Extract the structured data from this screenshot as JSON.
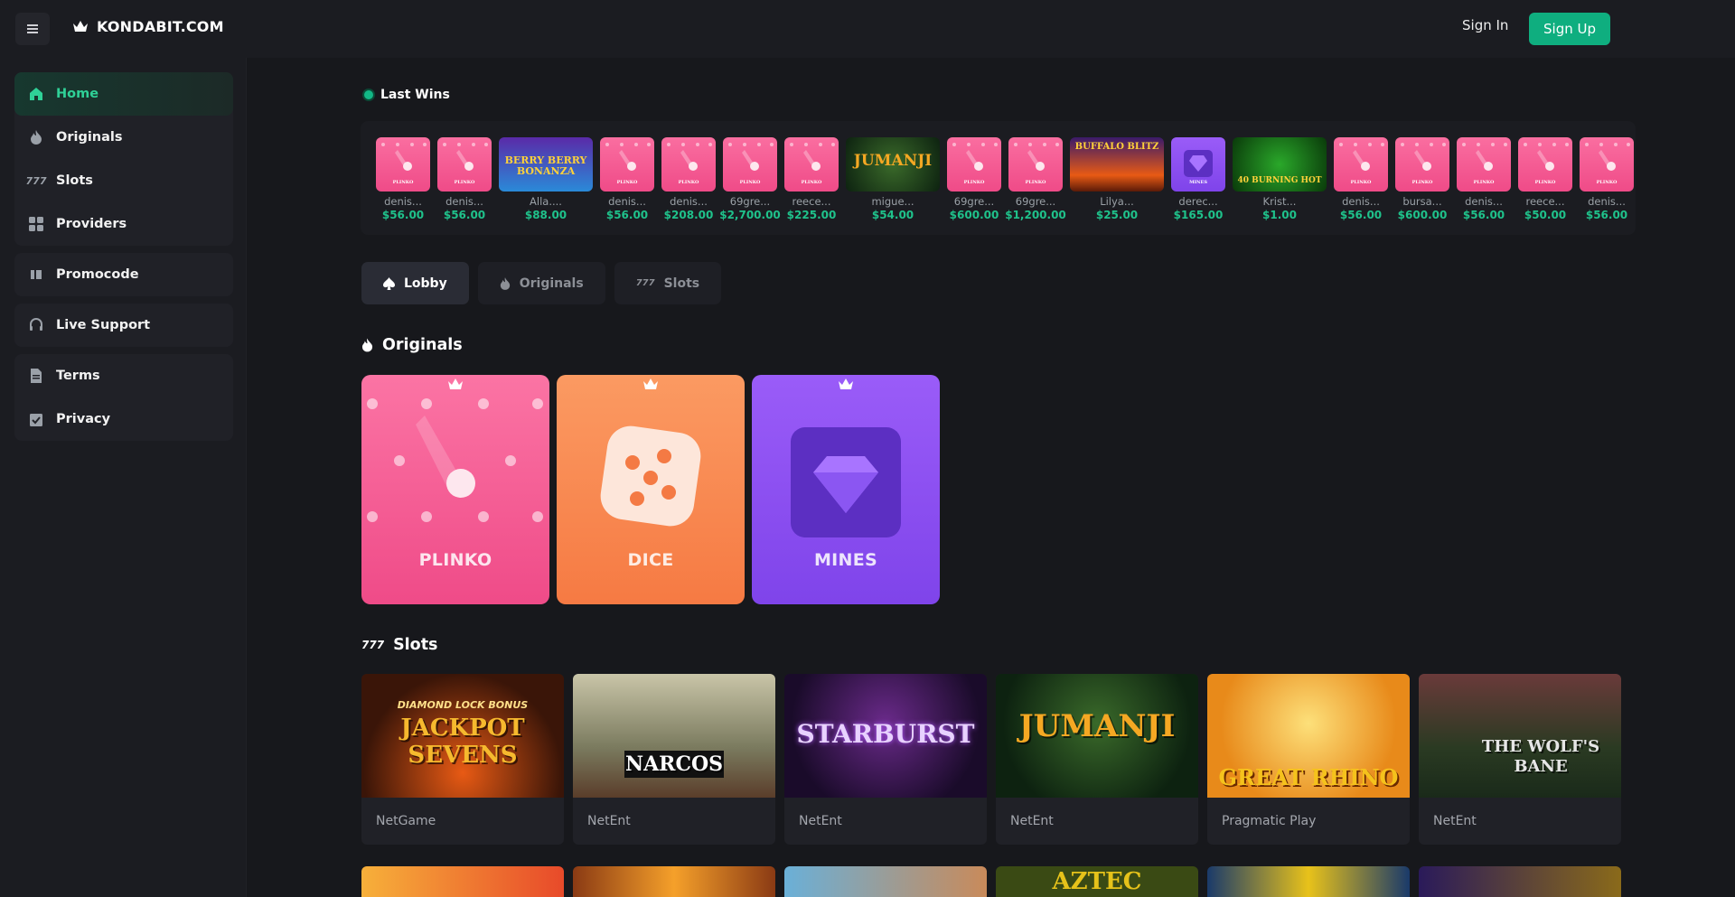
{
  "header": {
    "logo_text": "KONDABIT.COM",
    "signin_label": "Sign In",
    "signup_label": "Sign Up"
  },
  "sidebar": {
    "items": [
      {
        "label": "Home",
        "icon": "home-icon"
      },
      {
        "label": "Originals",
        "icon": "flame-icon"
      },
      {
        "label": "Slots",
        "icon": "slots-777-icon"
      },
      {
        "label": "Providers",
        "icon": "grid-icon"
      },
      {
        "label": "Promocode",
        "icon": "ticket-icon"
      },
      {
        "label": "Live Support",
        "icon": "headset-icon"
      },
      {
        "label": "Terms",
        "icon": "document-icon"
      },
      {
        "label": "Privacy",
        "icon": "clipboard-check-icon"
      }
    ]
  },
  "last_wins": {
    "title": "Last Wins",
    "items": [
      {
        "user": "denis...",
        "amount": "$56.00",
        "game": "plinko"
      },
      {
        "user": "denis...",
        "amount": "$56.00",
        "game": "plinko"
      },
      {
        "user": "Alla....",
        "amount": "$88.00",
        "game": "berry-bonanza"
      },
      {
        "user": "denis...",
        "amount": "$56.00",
        "game": "plinko"
      },
      {
        "user": "denis...",
        "amount": "$208.00",
        "game": "plinko"
      },
      {
        "user": "69gre...",
        "amount": "$2,700.00",
        "game": "plinko"
      },
      {
        "user": "reece...",
        "amount": "$225.00",
        "game": "plinko"
      },
      {
        "user": "migue...",
        "amount": "$54.00",
        "game": "jumanji"
      },
      {
        "user": "69gre...",
        "amount": "$600.00",
        "game": "plinko"
      },
      {
        "user": "69gre...",
        "amount": "$1,200.00",
        "game": "plinko"
      },
      {
        "user": "Lilya...",
        "amount": "$25.00",
        "game": "buffalo"
      },
      {
        "user": "derec...",
        "amount": "$165.00",
        "game": "mines"
      },
      {
        "user": "Krist...",
        "amount": "$1.00",
        "game": "burning-hot"
      },
      {
        "user": "denis...",
        "amount": "$56.00",
        "game": "plinko"
      },
      {
        "user": "bursa...",
        "amount": "$600.00",
        "game": "plinko"
      },
      {
        "user": "denis...",
        "amount": "$56.00",
        "game": "plinko"
      },
      {
        "user": "reece...",
        "amount": "$50.00",
        "game": "plinko"
      },
      {
        "user": "denis...",
        "amount": "$56.00",
        "game": "plinko"
      }
    ],
    "thumb_labels": {
      "plinko": "PLINKO",
      "mines": "MINES",
      "berry": "BERRY BERRY BONANZA",
      "jumanji": "JUMANJI",
      "buffalo": "BUFFALO BLITZ",
      "burning": "40 BURNING HOT"
    }
  },
  "tabs": [
    {
      "label": "Lobby",
      "icon": "spade-icon",
      "active": true
    },
    {
      "label": "Originals",
      "icon": "flame-icon",
      "active": false
    },
    {
      "label": "Slots",
      "icon": "slots-777-icon",
      "active": false
    }
  ],
  "originals": {
    "title": "Originals",
    "games": [
      {
        "name": "PLINKO",
        "color": "#f2588f"
      },
      {
        "name": "DICE",
        "color": "#f78a52"
      },
      {
        "name": "MINES",
        "color": "#8a4df0"
      }
    ]
  },
  "slots": {
    "title": "Slots",
    "games": [
      {
        "title": "JACKPOT SEVENS",
        "subtitle": "DIAMOND LOCK BONUS",
        "provider": "NetGame"
      },
      {
        "title": "NARCOS",
        "provider": "NetEnt"
      },
      {
        "title": "STARBURST",
        "provider": "NetEnt"
      },
      {
        "title": "JUMANJI",
        "provider": "NetEnt"
      },
      {
        "title": "GREAT RHINO",
        "provider": "Pragmatic Play"
      },
      {
        "title": "THE WOLF'S BANE",
        "provider": "NetEnt"
      }
    ],
    "second_row_title": "AZTEC"
  },
  "colors": {
    "accent": "#0fae7f",
    "win_green": "#1fc28b",
    "bg": "#17181c",
    "panel": "#1b1c21"
  }
}
